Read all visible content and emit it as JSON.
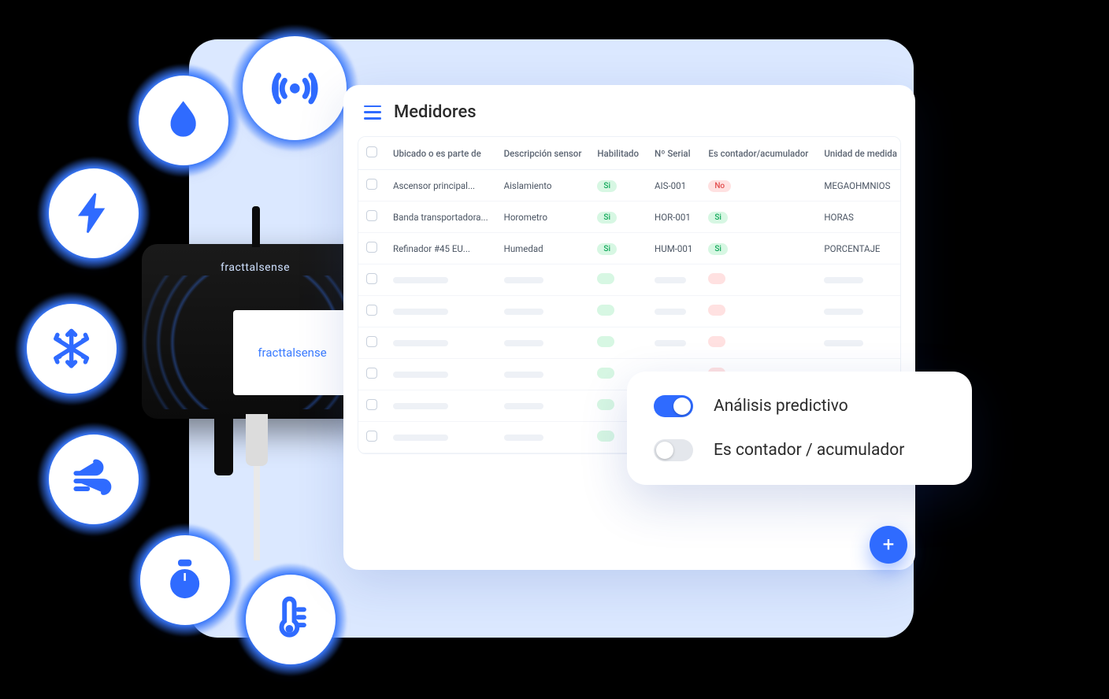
{
  "brand": "fracttalsense",
  "header": {
    "title": "Medidores"
  },
  "columns": {
    "c0": "",
    "c1": "Ubicado o es parte de",
    "c2": "Descripción sensor",
    "c3": "Habilitado",
    "c4": "Nº Serial",
    "c5": "Es contador/acumulador",
    "c6": "Unidad de medida"
  },
  "rows": [
    {
      "loc": "Ascensor principal...",
      "desc": "Aislamiento",
      "enabled": "Si",
      "serial": "AIS-001",
      "counter": "No",
      "unit": "MEGAOHMNIOS"
    },
    {
      "loc": "Banda transportadora...",
      "desc": "Horometro",
      "enabled": "Si",
      "serial": "HOR-001",
      "counter": "Si",
      "unit": "HORAS"
    },
    {
      "loc": "Refinador #45 EU...",
      "desc": "Humedad",
      "enabled": "Si",
      "serial": "HUM-001",
      "counter": "Si",
      "unit": "PORCENTAJE"
    }
  ],
  "pill": {
    "si": "Si",
    "no": "No"
  },
  "toggles": {
    "predictive": {
      "label": "Análisis predictivo",
      "on": true
    },
    "counter": {
      "label": "Es contador / acumulador",
      "on": false
    }
  },
  "fab_label": "+"
}
